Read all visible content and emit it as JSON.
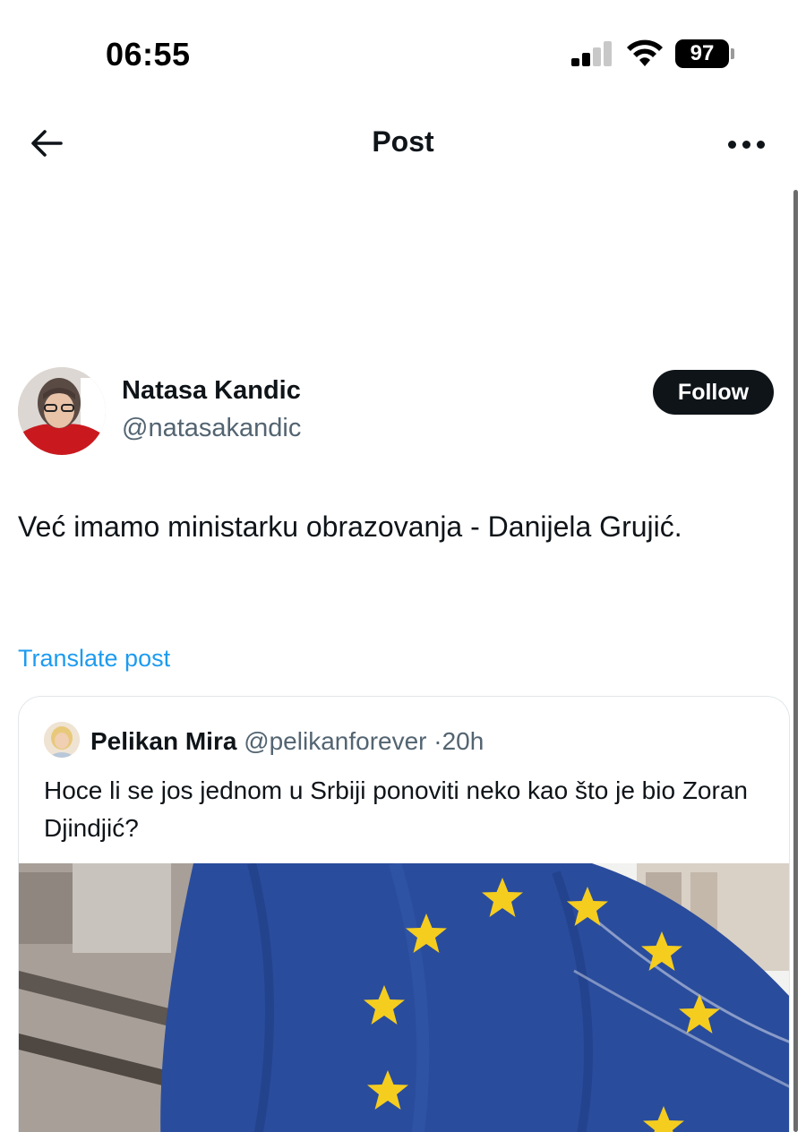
{
  "status_bar": {
    "time": "06:55",
    "battery": "97"
  },
  "nav": {
    "title": "Post"
  },
  "post": {
    "author": {
      "name": "Natasa Kandic",
      "handle": "@natasakandic"
    },
    "follow_label": "Follow",
    "text": "Već imamo ministarku obrazovanja - Danijela Grujić.",
    "translate_label": "Translate post"
  },
  "quote": {
    "author_name": "Pelikan Mira",
    "handle": "@pelikanforever",
    "separator": "·",
    "time": "20h",
    "text": "Hoce li se jos jednom u Srbiji ponoviti neko kao što je bio Zoran Djindjić?"
  },
  "colors": {
    "link": "#1d9bf0",
    "text_primary": "#0f1419",
    "text_secondary": "#536471",
    "eu_blue": "#2a4c9c",
    "eu_star": "#f5cd1f"
  }
}
